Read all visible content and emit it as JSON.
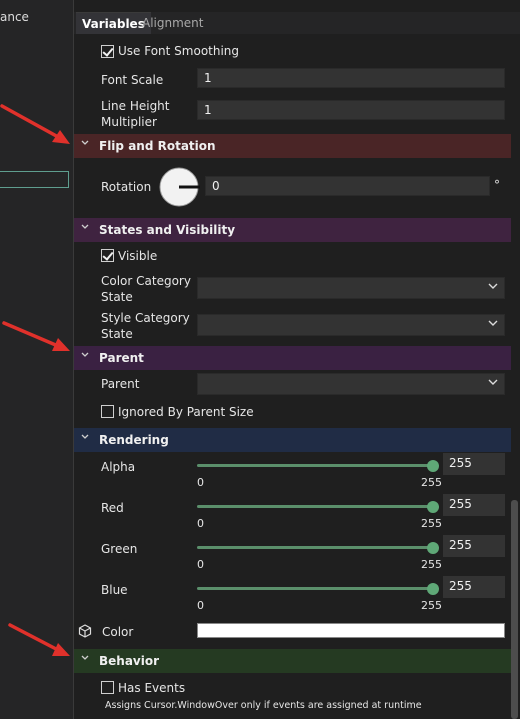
{
  "left": {
    "label": "ance"
  },
  "tabs": [
    {
      "label": "Variables"
    },
    {
      "label": "Alignment"
    }
  ],
  "text": {
    "use_font_smoothing": "Use Font Smoothing",
    "font_scale_label": "Font Scale",
    "font_scale_value": "1",
    "line_height_label_1": "Line Height",
    "line_height_label_2": "Multiplier",
    "line_height_value": "1"
  },
  "flip": {
    "title": "Flip and Rotation",
    "rotation_label": "Rotation",
    "rotation_value": "0",
    "unit": "°"
  },
  "states": {
    "title": "States and Visibility",
    "visible_label": "Visible",
    "visible_checked": true,
    "color_category_1": "Color Category",
    "color_category_2": "State",
    "style_category_1": "Style Category",
    "style_category_2": "State"
  },
  "parent": {
    "title": "Parent",
    "parent_label": "Parent",
    "ignored_label": "Ignored By Parent Size",
    "ignored_checked": false
  },
  "rendering": {
    "title": "Rendering",
    "sliders": [
      {
        "label": "Alpha",
        "min": "0",
        "max": "255",
        "value": "255",
        "fraction": 1.0
      },
      {
        "label": "Red",
        "min": "0",
        "max": "255",
        "value": "255",
        "fraction": 1.0
      },
      {
        "label": "Green",
        "min": "0",
        "max": "255",
        "value": "255",
        "fraction": 1.0
      },
      {
        "label": "Blue",
        "min": "0",
        "max": "255",
        "value": "255",
        "fraction": 1.0
      }
    ],
    "color_label": "Color",
    "color_value": "#ffffff"
  },
  "behavior": {
    "title": "Behavior",
    "has_events_label": "Has Events",
    "has_events_checked": false,
    "note": "Assigns Cursor.WindowOver only if events are assigned at runtime"
  },
  "colors": {
    "flip_header": "#4a2526",
    "states_header": "#3f2340",
    "parent_header": "#3a2142",
    "rendering_header": "#202c45",
    "behavior_header": "#253a22",
    "annotation_arrow": "#e0312b"
  }
}
